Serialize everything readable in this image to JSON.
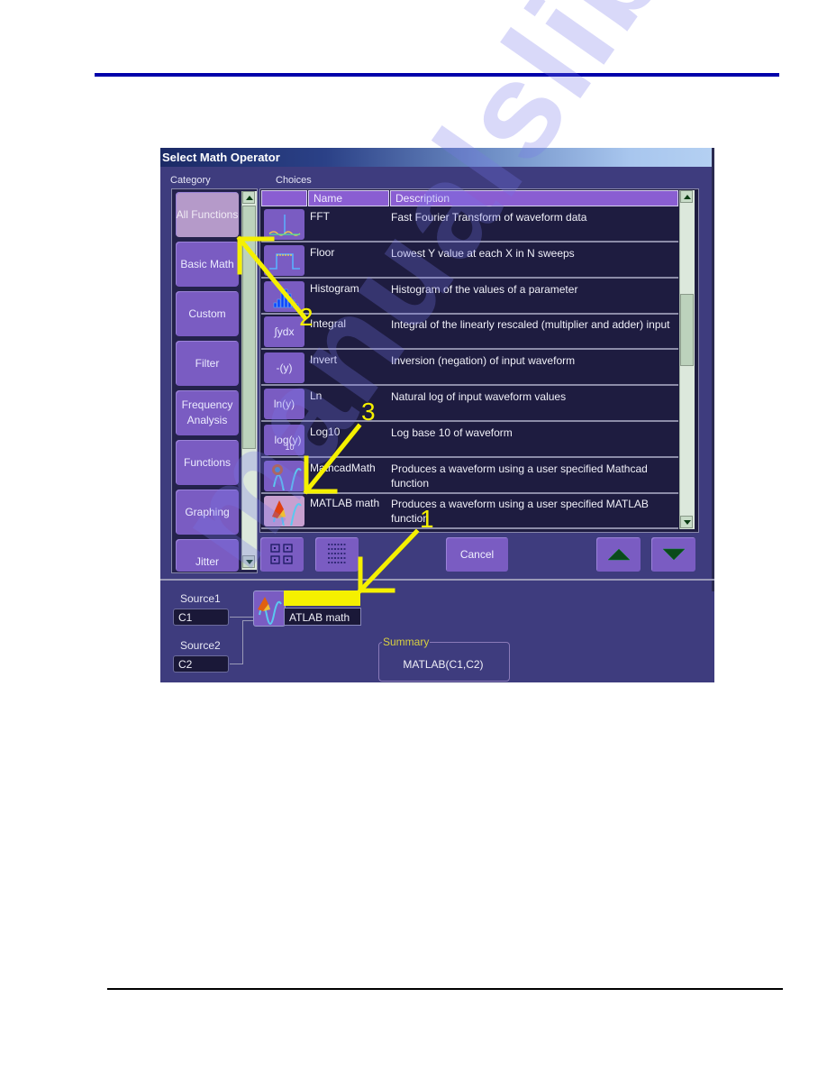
{
  "window": {
    "title": "Select Math Operator"
  },
  "category": {
    "label": "Category",
    "items": [
      {
        "label": "All Functions",
        "active": true
      },
      {
        "label": "Basic Math"
      },
      {
        "label": "Custom"
      },
      {
        "label": "Filter"
      },
      {
        "label": "Frequency Analysis"
      },
      {
        "label": "Functions"
      },
      {
        "label": "Graphing"
      },
      {
        "label": "Jitter"
      }
    ]
  },
  "choices": {
    "label": "Choices",
    "columns": {
      "icon": "",
      "name": "Name",
      "description": "Description"
    },
    "rows": [
      {
        "icon": "fft-icon",
        "icon_text": "",
        "name": "FFT",
        "description": "Fast Fourier Transform of waveform data"
      },
      {
        "icon": "floor-icon",
        "icon_text": "",
        "name": "Floor",
        "description": "Lowest Y value at each X in N sweeps"
      },
      {
        "icon": "histogram-icon",
        "icon_text": "",
        "name": "Histogram",
        "description": "Histogram of the values of a parameter"
      },
      {
        "icon": "integral-icon",
        "icon_text": "∫ydx",
        "name": "Integral",
        "description": "Integral of the linearly rescaled (multiplier and adder) input"
      },
      {
        "icon": "invert-icon",
        "icon_text": "-(y)",
        "name": "Invert",
        "description": "Inversion (negation) of input waveform"
      },
      {
        "icon": "ln-icon",
        "icon_text": "ln(y)",
        "name": "Ln",
        "description": "Natural log of input waveform values"
      },
      {
        "icon": "log10-icon",
        "icon_text": "log(y)",
        "icon_sub": "10",
        "name": "Log10",
        "description": "Log base 10 of waveform"
      },
      {
        "icon": "mathcad-icon",
        "icon_text": "",
        "name": "MathcadMath",
        "description": "Produces a waveform using a user specified Mathcad function"
      },
      {
        "icon": "matlab-icon",
        "icon_text": "",
        "name": "MATLAB math",
        "description": "Produces a waveform using a user specified MATLAB function",
        "selected": true
      }
    ]
  },
  "toolbar": {
    "grid_view": "grid-view-icon",
    "list_view": "list-view-icon",
    "cancel_label": "Cancel",
    "page_up": "triangle-up-icon",
    "page_down": "triangle-down-icon"
  },
  "setup": {
    "source1_label": "Source1",
    "source1_value": "C1",
    "source2_label": "Source2",
    "source2_value": "C2",
    "operator_name": "ATLAB math",
    "summary_label": "Summary",
    "summary_value": "MATLAB(C1,C2)"
  },
  "annotations": {
    "arrow_color": "#f5f000",
    "numbers": [
      "1",
      "2",
      "3"
    ]
  },
  "watermark": "manualslib"
}
